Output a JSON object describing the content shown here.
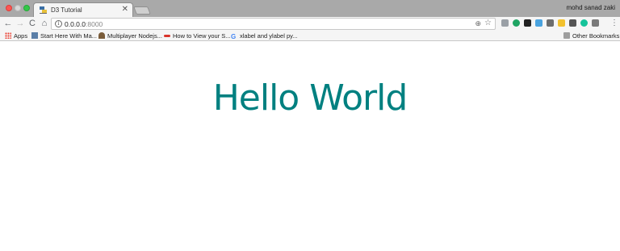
{
  "window": {
    "profile_name": "mohd sanad zaki"
  },
  "tab": {
    "title": "D3 Tutorial",
    "close_glyph": "✕"
  },
  "toolbar": {
    "back_glyph": "←",
    "forward_glyph": "→",
    "reload_glyph": "C",
    "home_glyph": "⌂",
    "url_host": "0.0.0.0",
    "url_port": ":8000",
    "info_glyph": "i",
    "zoom_glyph": "⊕",
    "star_glyph": "☆",
    "menu_glyph": "⋮"
  },
  "extensions": [
    {
      "name": "extension-dots-icon",
      "color": "#9aa0a6"
    },
    {
      "name": "extension-green-circle-icon",
      "color": "#1fa463"
    },
    {
      "name": "extension-arrow-icon",
      "color": "#222222"
    },
    {
      "name": "extension-blue-square-icon",
      "color": "#4aa3df"
    },
    {
      "name": "extension-plane-icon",
      "color": "#6d6d6d"
    },
    {
      "name": "extension-python-icon",
      "color": "#f2c12e"
    },
    {
      "name": "extension-dark-square-icon",
      "color": "#555555"
    },
    {
      "name": "extension-grammarly-icon",
      "color": "#15c39a"
    },
    {
      "name": "extension-translate-icon",
      "color": "#7a7a7a"
    }
  ],
  "bookmarks": {
    "apps": "Apps",
    "items": [
      {
        "label": "Start Here With Ma...",
        "icon": "photo-icon",
        "color": "#5b7fa8"
      },
      {
        "label": "Multiplayer Nodejs...",
        "icon": "chess-icon",
        "color": "#7a5c3a"
      },
      {
        "label": "How to View your S...",
        "icon": "swoosh-icon",
        "color": "#d9342b"
      },
      {
        "label": "xlabel and ylabel py...",
        "icon": "google-icon",
        "color": "#4285f4"
      }
    ],
    "other": "Other Bookmarks"
  },
  "page": {
    "heading": "Hello World",
    "heading_color": "#008080"
  }
}
